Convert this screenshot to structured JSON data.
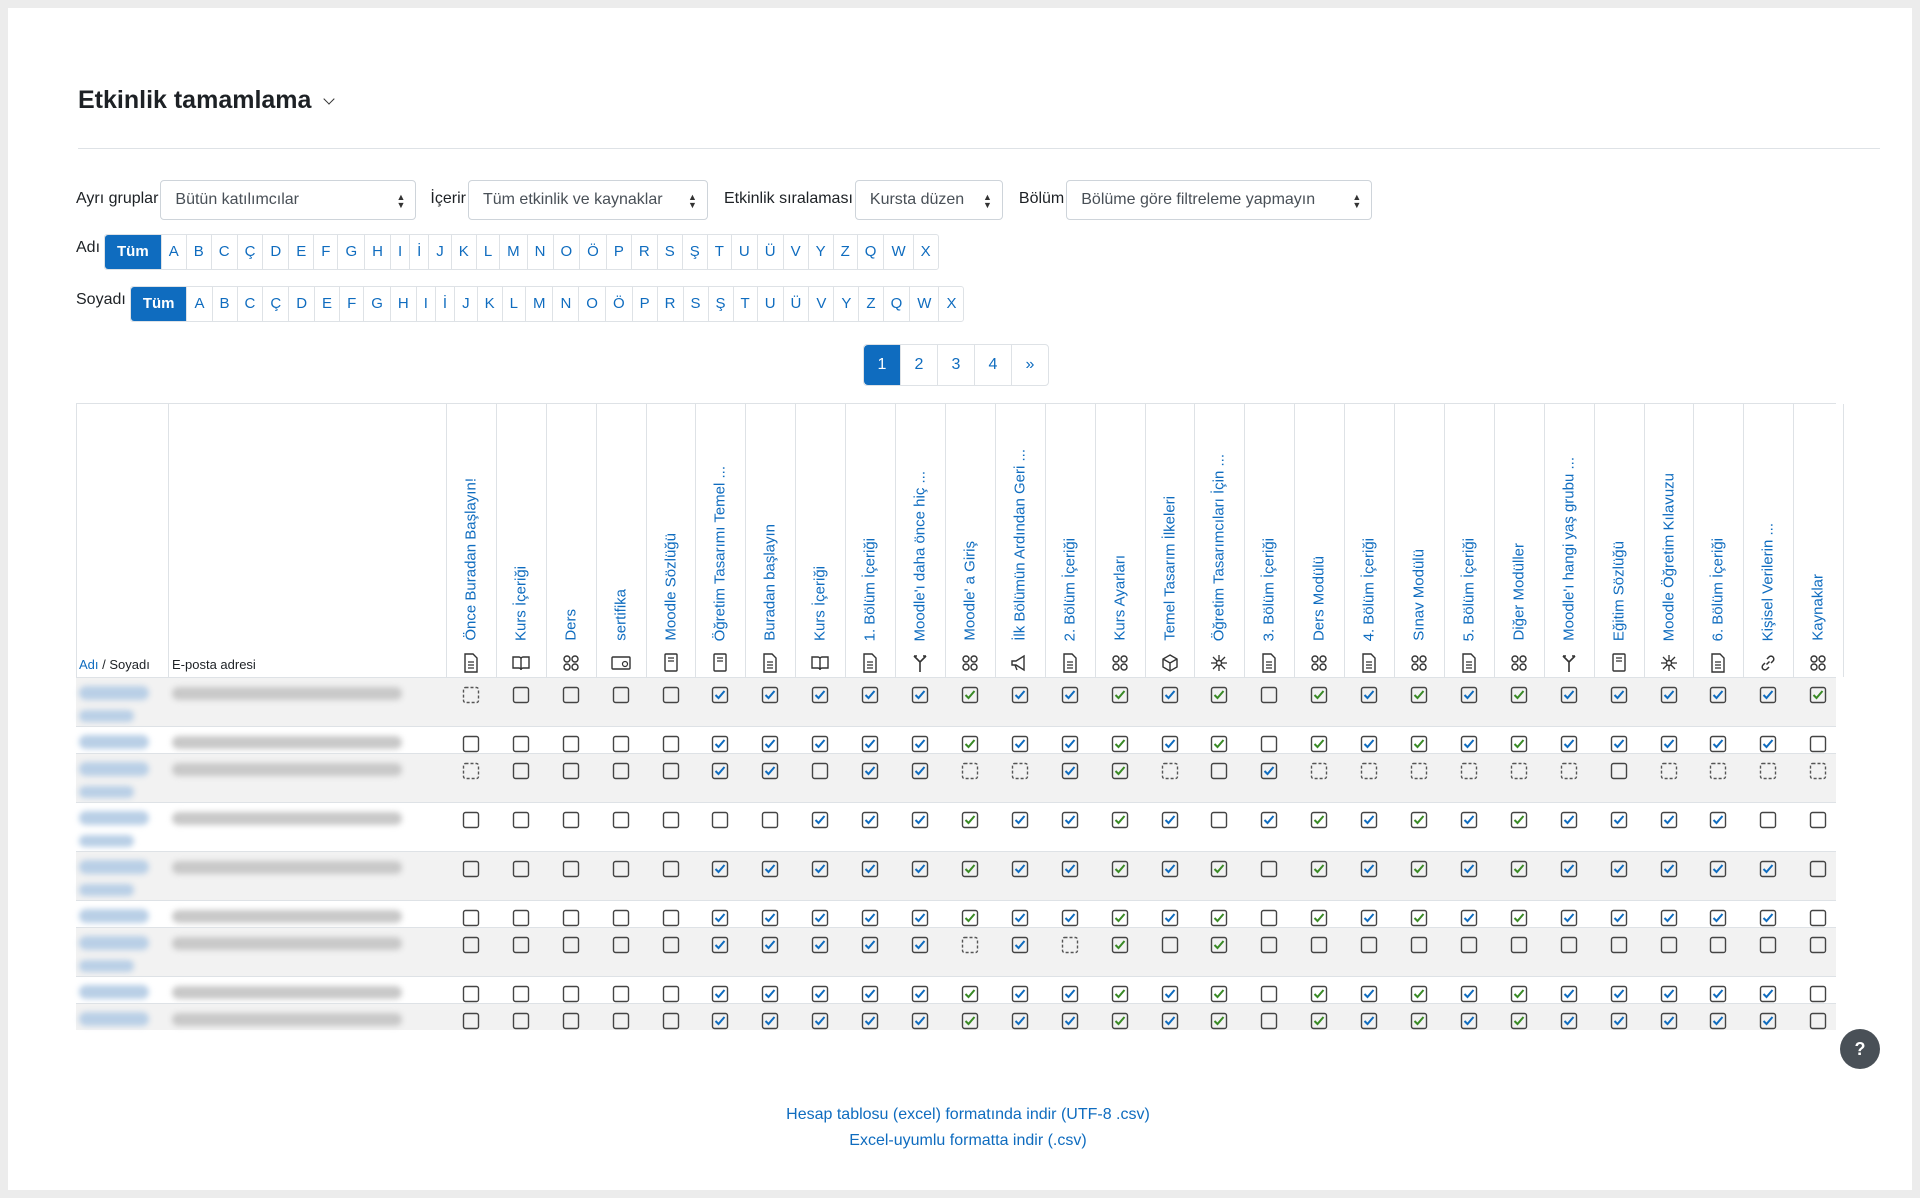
{
  "page": {
    "title": "Etkinlik tamamlama"
  },
  "filters": [
    {
      "label": "Ayrı gruplar",
      "value": "Bütün katılımcılar"
    },
    {
      "label": "İçerir",
      "value": "Tüm etkinlik ve kaynaklar"
    },
    {
      "label": "Etkinlik sıralaması",
      "value": "Kursta düzen"
    },
    {
      "label": "Bölüm",
      "value": "Bölüme göre filtreleme yapmayın"
    }
  ],
  "name_filter": {
    "first_label": "Adı",
    "last_label": "Soyadı",
    "all_label": "Tüm",
    "letters": [
      "A",
      "B",
      "C",
      "Ç",
      "D",
      "E",
      "F",
      "G",
      "H",
      "I",
      "İ",
      "J",
      "K",
      "L",
      "M",
      "N",
      "O",
      "Ö",
      "P",
      "R",
      "S",
      "Ş",
      "T",
      "U",
      "Ü",
      "V",
      "Y",
      "Z",
      "Q",
      "W",
      "X"
    ]
  },
  "pagination": {
    "pages": [
      "1",
      "2",
      "3",
      "4"
    ],
    "next": "»",
    "current": "1"
  },
  "table": {
    "header_first": "Adı",
    "header_sep": " / ",
    "header_last": "Soyadı",
    "header_email": "E-posta adresi",
    "activities": [
      {
        "name": "Önce Buradan Başlayın!",
        "icon": "page-icon"
      },
      {
        "name": "Kurs İçeriği",
        "icon": "book-icon"
      },
      {
        "name": "Ders",
        "icon": "activity-icon"
      },
      {
        "name": "sertifika",
        "icon": "certificate-icon"
      },
      {
        "name": "Moodle Sözlüğü",
        "icon": "glossary-icon"
      },
      {
        "name": "Öğretim Tasarımı Temel ...",
        "icon": "glossary-icon"
      },
      {
        "name": "Buradan başlayın",
        "icon": "page-icon"
      },
      {
        "name": "Kurs İçeriği",
        "icon": "book-icon"
      },
      {
        "name": "1. Bölüm İçeriği",
        "icon": "page-icon"
      },
      {
        "name": "Moodle'ı daha önce hiç ...",
        "icon": "choice-icon"
      },
      {
        "name": "Moodle' a Giriş",
        "icon": "activity-icon"
      },
      {
        "name": "İlk Bölümün Ardından Geri ...",
        "icon": "feedback-icon"
      },
      {
        "name": "2. Bölüm İçeriği",
        "icon": "page-icon"
      },
      {
        "name": "Kurs Ayarları",
        "icon": "activity-icon"
      },
      {
        "name": "Temel Tasarım İlkeleri",
        "icon": "scorm-icon"
      },
      {
        "name": "Öğretim Tasarımcıları İçin ...",
        "icon": "network-icon"
      },
      {
        "name": "3. Bölüm İçeriği",
        "icon": "page-icon"
      },
      {
        "name": "Ders Modülü",
        "icon": "activity-icon"
      },
      {
        "name": "4. Bölüm İçeriği",
        "icon": "page-icon"
      },
      {
        "name": "Sınav Modülü",
        "icon": "activity-icon"
      },
      {
        "name": "5. Bölüm İçeriği",
        "icon": "page-icon"
      },
      {
        "name": "Diğer Modüller",
        "icon": "activity-icon"
      },
      {
        "name": "Moodle'ı hangi yaş grubu ...",
        "icon": "choice-icon"
      },
      {
        "name": "Eğitim Sözlüğü",
        "icon": "glossary-icon"
      },
      {
        "name": "Moodle Öğretim Kılavuzu",
        "icon": "network-icon"
      },
      {
        "name": "6. Bölüm İçeriği",
        "icon": "page-icon"
      },
      {
        "name": "Kişisel Verilerin ...",
        "icon": "url-icon"
      },
      {
        "name": "Kaynaklar",
        "icon": "activity-icon"
      }
    ],
    "rows": [
      {
        "states": "aammmmcccccccccccmccccccccccc"
      },
      {
        "states": "ammmmmcccccccccccmcccccccccc"
      },
      {
        "states": "aammmmccmccaaccamcaaaaaamaaaa"
      },
      {
        "states": "ammmmmmmccccccccmcccccccccc"
      },
      {
        "states": "ammmmmcccccccccccmcccccccccc"
      },
      {
        "states": "ammmmmcccccccccccmcccccccccc"
      },
      {
        "states": "ammmmmcccccacacmcmmmmmmmmmm"
      },
      {
        "states": "ammmmmcccccccccccmcccccccccc"
      },
      {
        "states": "ammmmmcccccccccccmcccccccccc"
      }
    ],
    "legend_note": "m = manual unchecked, a = automatic unchecked, c = completed"
  },
  "downloads": {
    "csv_utf8": "Hesap tablosu (excel) formatında indir (UTF-8 .csv)",
    "csv_excel": "Excel-uyumlu formatta indir (.csv)"
  },
  "help": {
    "label": "?"
  },
  "colors": {
    "link": "#0f6cbf",
    "check_manual": "#0f6cbf",
    "check_auto": "#398a25",
    "border": "#dee2e6"
  }
}
